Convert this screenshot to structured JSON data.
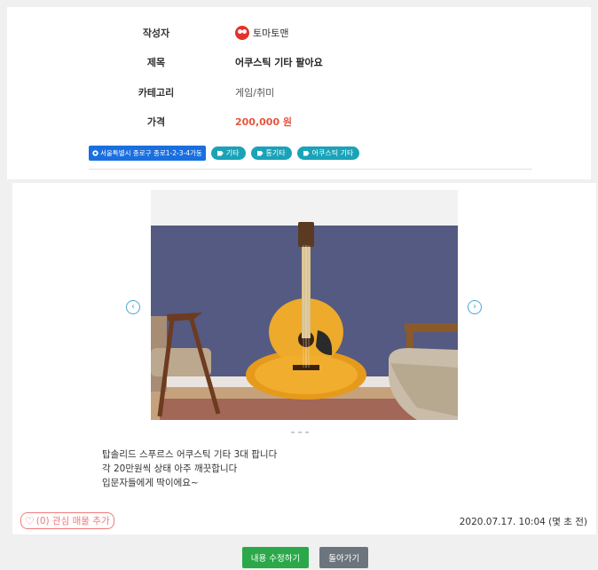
{
  "post": {
    "author_label": "작성자",
    "author_name": "토마토맨",
    "title_label": "제목",
    "title": "어쿠스틱 기타 팔아요",
    "category_label": "카테고리",
    "category": "게임/취미",
    "price_label": "가격",
    "price": "200,000 원"
  },
  "location": "서울특별시 종로구 종로1-2-3-4가동",
  "tags": [
    "기타",
    "통기타",
    "어쿠스틱 기타"
  ],
  "description": [
    "탑솔리드 스푸르스 어쿠스틱 기타 3대 팝니다",
    "각 20만원씩 상태 아주 깨끗합니다",
    "입문자들에게 딱이에요~"
  ],
  "like_button": "(0) 관심 매물 추가",
  "date": "2020.07.17. 10:04 (몇 초 전)",
  "buttons": {
    "edit": "내용 수정하기",
    "back": "돌아가기"
  },
  "icons": {
    "carousel_prev": "chevron-left-icon",
    "carousel_next": "chevron-right-icon",
    "tag": "tag-icon",
    "heart": "heart-icon",
    "location": "location-icon"
  },
  "colors": {
    "price": "#e8553d",
    "tag": "#1aa3b8",
    "location": "#1a6fe0",
    "edit_button": "#2ba84a",
    "back_button": "#6c757d",
    "like": "#f07a7a"
  }
}
